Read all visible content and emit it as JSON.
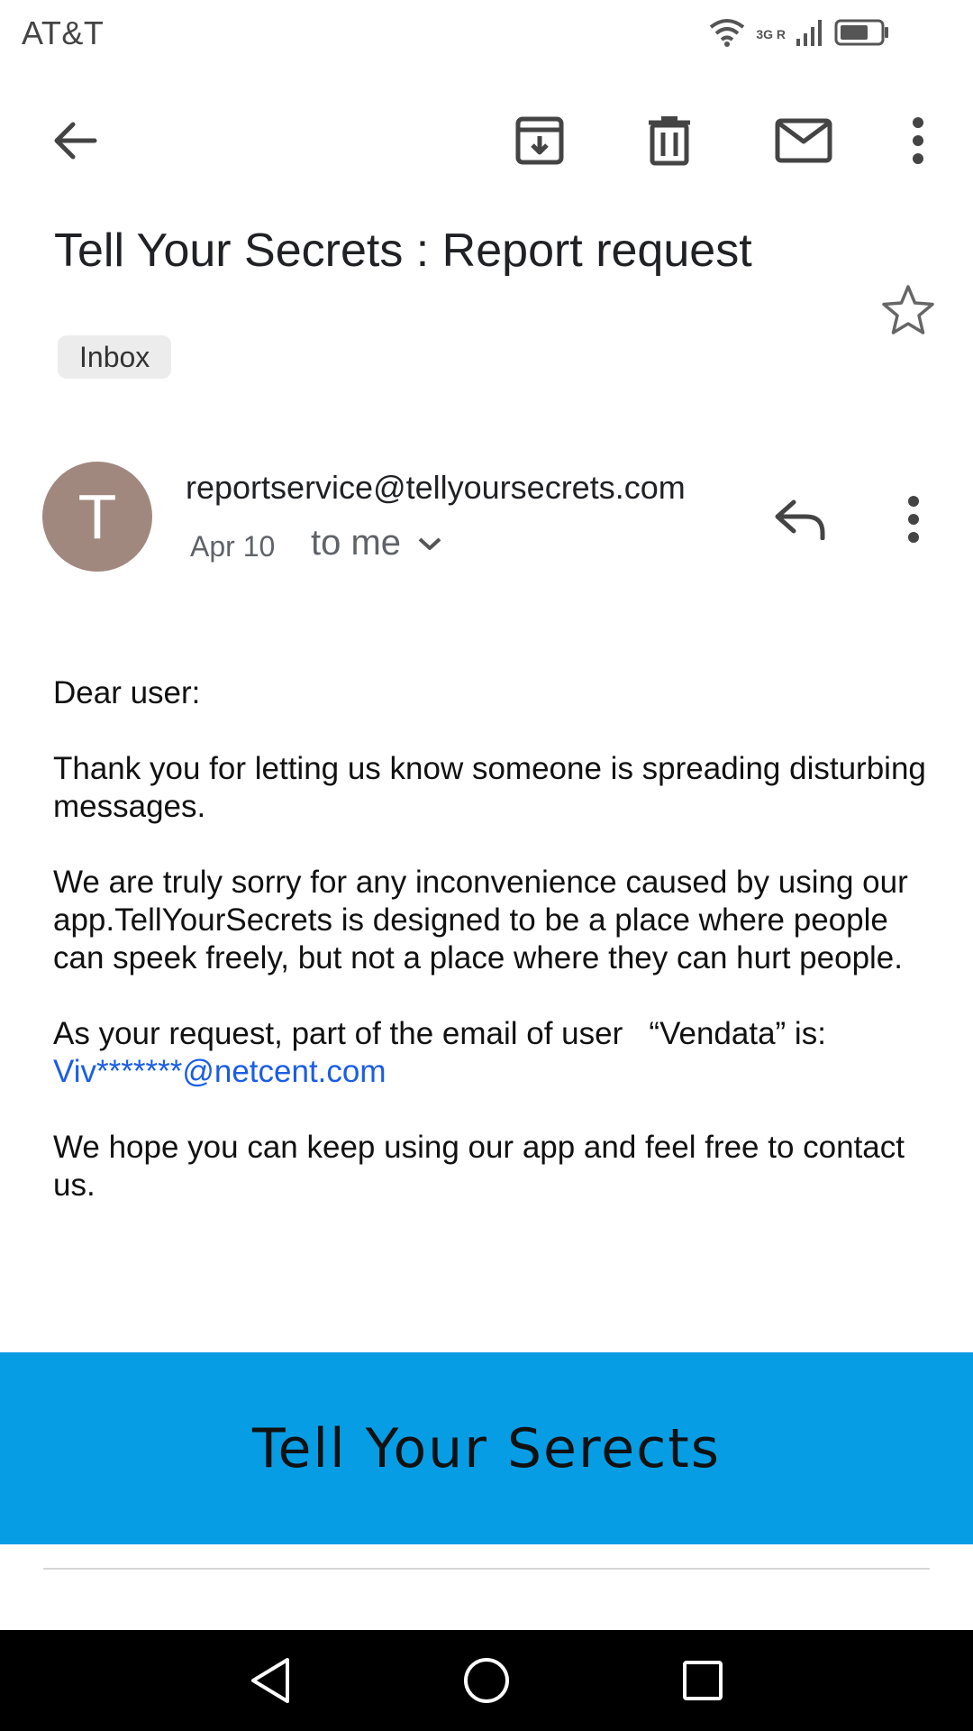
{
  "status_bar": {
    "carrier": "AT&T",
    "network_label": "3G R"
  },
  "toolbar": {
    "icons": [
      "back-arrow-icon",
      "archive-icon",
      "delete-icon",
      "mark-unread-icon",
      "more-vert-icon"
    ]
  },
  "email": {
    "subject": "Tell Your Secrets : Report request",
    "label": "Inbox",
    "sender": {
      "avatar_letter": "T",
      "avatar_color": "#a1887f",
      "address": "reportservice@tellyoursecrets.com",
      "date": "Apr 10",
      "recipient": "to me"
    },
    "body": {
      "greeting": "Dear user:",
      "para1": "Thank you for letting us know someone is spreading disturbing messages.",
      "para2": "We are truly sorry for any inconvenience caused by using our app.TellYourSecrets is designed to be a place where people can speek freely, but not a place where they can hurt people.",
      "para3": "As your request, part of the email of user   “Vendata” is:",
      "email_link": "Viv*******@netcent.com",
      "para4": "We hope you can keep using our app and feel free to contact us."
    },
    "banner": {
      "title": "Tell Your Serects",
      "color": "#069de4"
    }
  },
  "nav_bar": {
    "icons": [
      "back-triangle-icon",
      "home-circle-icon",
      "recents-square-icon"
    ]
  }
}
